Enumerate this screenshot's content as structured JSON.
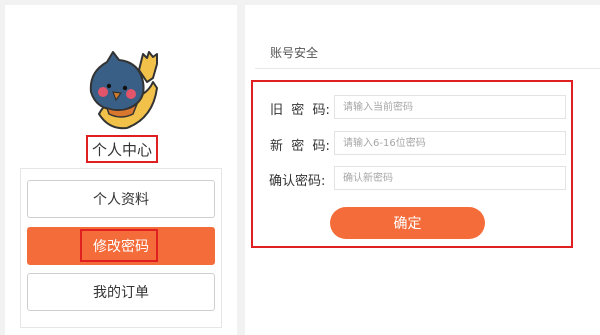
{
  "profile": {
    "title": "个人中心"
  },
  "menu": {
    "items": [
      {
        "label": "个人资料",
        "active": false
      },
      {
        "label": "修改密码",
        "active": true
      },
      {
        "label": "我的订单",
        "active": false
      }
    ]
  },
  "security": {
    "section_title": "账号安全",
    "fields": [
      {
        "label": "旧  密  码:",
        "placeholder": "请输入当前密码",
        "value": ""
      },
      {
        "label": "新  密  码:",
        "placeholder": "请输入6-16位密码",
        "value": ""
      },
      {
        "label": "确认密码:",
        "placeholder": "确认新密码",
        "value": ""
      }
    ],
    "confirm_label": "确定"
  },
  "colors": {
    "accent": "#f46c3a",
    "highlight_outline": "#e02020",
    "background": "#f2f2f2"
  }
}
